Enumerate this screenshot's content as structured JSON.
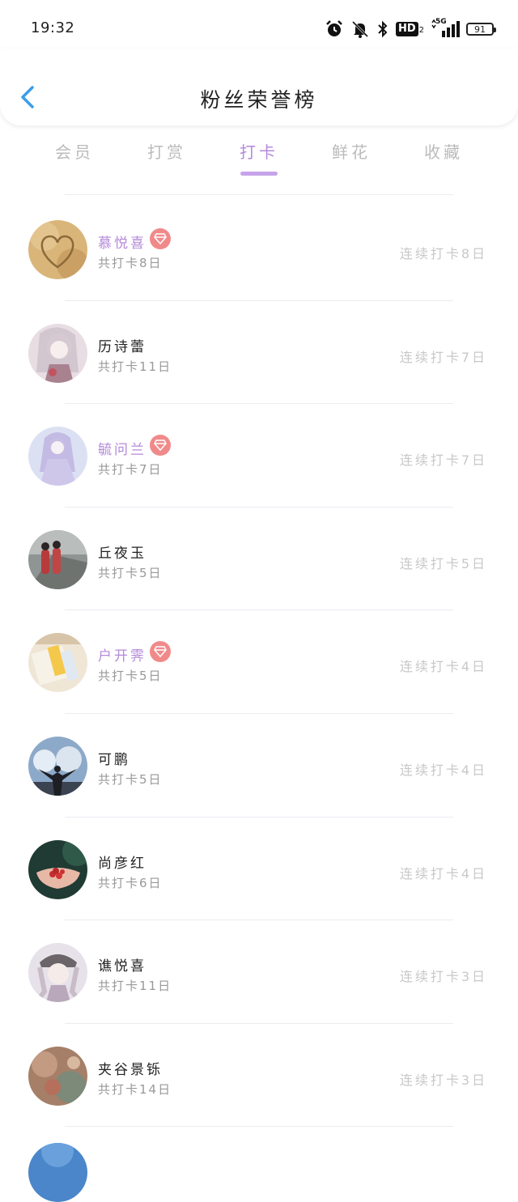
{
  "status_bar": {
    "time": "19:32",
    "hd_label": "HD",
    "hd_sub": "2",
    "network_label": "5G",
    "battery": "91",
    "icons": [
      "alarm-icon",
      "mute-bell-icon",
      "bluetooth-icon",
      "hd-voice-icon",
      "signal-icon",
      "battery-icon"
    ]
  },
  "header": {
    "title": "粉丝荣誉榜",
    "back_icon": "chevron-left-icon"
  },
  "tabs": [
    {
      "label": "会员",
      "active": false
    },
    {
      "label": "打赏",
      "active": false
    },
    {
      "label": "打卡",
      "active": true
    },
    {
      "label": "鲜花",
      "active": false
    },
    {
      "label": "收藏",
      "active": false
    }
  ],
  "colors": {
    "accent": "#b48ad8",
    "badge": "#f08a8a",
    "back_arrow": "#3a9ee8",
    "muted": "#c8c8c8"
  },
  "list": [
    {
      "name": "慕悦喜",
      "vip": true,
      "total": "共打卡8日",
      "streak": "连续打卡8日"
    },
    {
      "name": "历诗蕾",
      "vip": false,
      "total": "共打卡11日",
      "streak": "连续打卡7日"
    },
    {
      "name": "毓问兰",
      "vip": true,
      "total": "共打卡7日",
      "streak": "连续打卡7日"
    },
    {
      "name": "丘夜玉",
      "vip": false,
      "total": "共打卡5日",
      "streak": "连续打卡5日"
    },
    {
      "name": "户开霁",
      "vip": true,
      "total": "共打卡5日",
      "streak": "连续打卡4日"
    },
    {
      "name": "可鹏",
      "vip": false,
      "total": "共打卡5日",
      "streak": "连续打卡4日"
    },
    {
      "name": "尚彦红",
      "vip": false,
      "total": "共打卡6日",
      "streak": "连续打卡4日"
    },
    {
      "name": "谯悦喜",
      "vip": false,
      "total": "共打卡11日",
      "streak": "连续打卡3日"
    },
    {
      "name": "夹谷景铄",
      "vip": false,
      "total": "共打卡14日",
      "streak": "连续打卡3日"
    }
  ]
}
